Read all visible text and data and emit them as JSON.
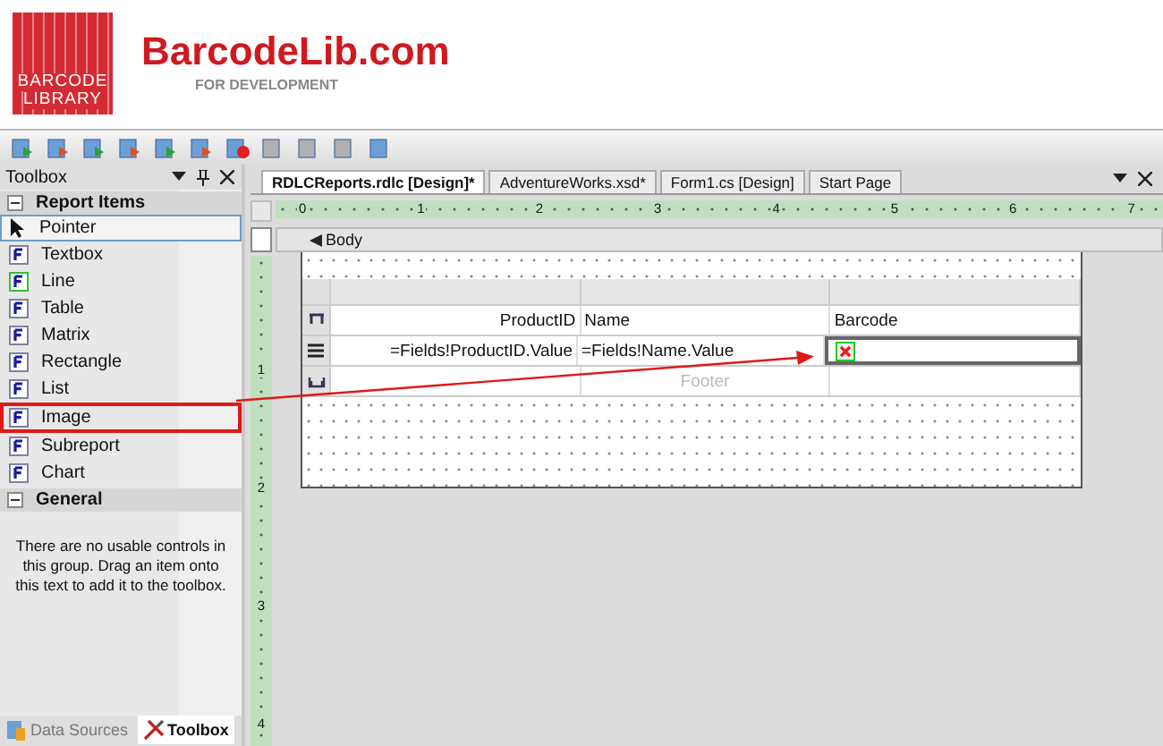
{
  "header": {
    "badge_lines": [
      "BARCODE",
      "LIBRARY"
    ],
    "brand": "BarcodeLib.com",
    "tagline": "FOR DEVELOPMENT"
  },
  "toolbox": {
    "title": "Toolbox",
    "groups": [
      {
        "name": "Report Items",
        "expanded": true,
        "items": [
          {
            "label": "Pointer",
            "kind": "pointer",
            "selected": true,
            "highlighted": false
          },
          {
            "label": "Textbox",
            "kind": "field",
            "selected": false,
            "highlighted": false
          },
          {
            "label": "Line",
            "kind": "field",
            "selected": false,
            "highlighted": false
          },
          {
            "label": "Table",
            "kind": "field",
            "selected": false,
            "highlighted": false
          },
          {
            "label": "Matrix",
            "kind": "field",
            "selected": false,
            "highlighted": false
          },
          {
            "label": "Rectangle",
            "kind": "field",
            "selected": false,
            "highlighted": false
          },
          {
            "label": "List",
            "kind": "field",
            "selected": false,
            "highlighted": false
          },
          {
            "label": "Image",
            "kind": "field",
            "selected": false,
            "highlighted": true
          },
          {
            "label": "Subreport",
            "kind": "field",
            "selected": false,
            "highlighted": false
          },
          {
            "label": "Chart",
            "kind": "field",
            "selected": false,
            "highlighted": false
          }
        ]
      },
      {
        "name": "General",
        "expanded": true,
        "message": "There are no usable controls in this group. Drag an item onto this text to add it to the toolbox."
      }
    ],
    "bottom_tabs": [
      {
        "label": "Data Sources",
        "selected": false
      },
      {
        "label": "Toolbox",
        "selected": true
      }
    ]
  },
  "designer": {
    "tabs": [
      {
        "label": "RDLCReports.rdlc [Design]*",
        "selected": true
      },
      {
        "label": "AdventureWorks.xsd*",
        "selected": false
      },
      {
        "label": "Form1.cs [Design]",
        "selected": false
      },
      {
        "label": "Start Page",
        "selected": false
      }
    ],
    "ruler": [
      "0",
      "1",
      "2",
      "3",
      "4",
      "5",
      "6",
      "7"
    ],
    "vertical_ruler": [
      "1",
      "2",
      "3",
      "4"
    ],
    "body_label": "Body",
    "table": {
      "header": [
        "ProductID",
        "Name",
        "Barcode"
      ],
      "details": [
        "=Fields!ProductID.Value",
        "=Fields!Name.Value"
      ],
      "footer_label": "Footer"
    }
  }
}
